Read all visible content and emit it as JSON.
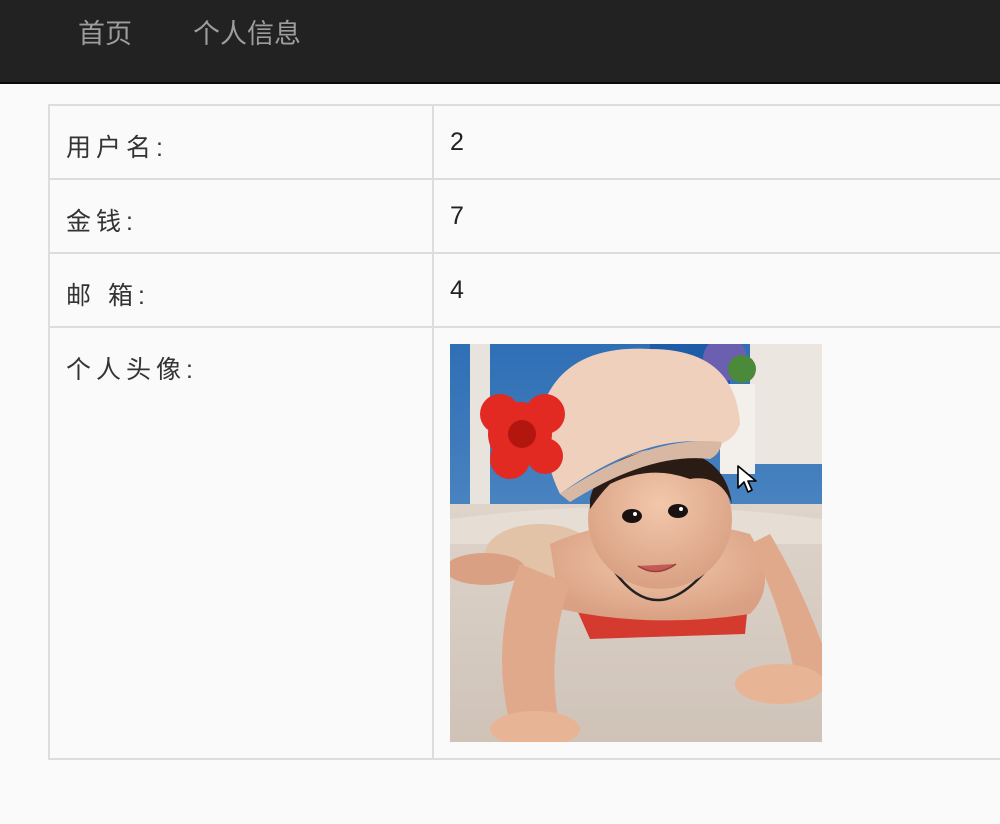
{
  "navbar": {
    "items": [
      {
        "label": "首页"
      },
      {
        "label": "个人信息"
      }
    ]
  },
  "profile": {
    "rows": [
      {
        "label": "用户名:",
        "value": "2"
      },
      {
        "label": "金钱:",
        "value": "7"
      },
      {
        "label": "邮 箱:",
        "value": "4"
      },
      {
        "label": "个人头像:"
      }
    ]
  },
  "colors": {
    "navbar_bg": "#222222",
    "nav_text": "#9d9d9d",
    "table_border": "#dddddd",
    "page_bg": "#fafafa"
  },
  "icons": {
    "avatar": "avatar-photo-child-in-cap",
    "cursor": "mouse-pointer-icon"
  }
}
